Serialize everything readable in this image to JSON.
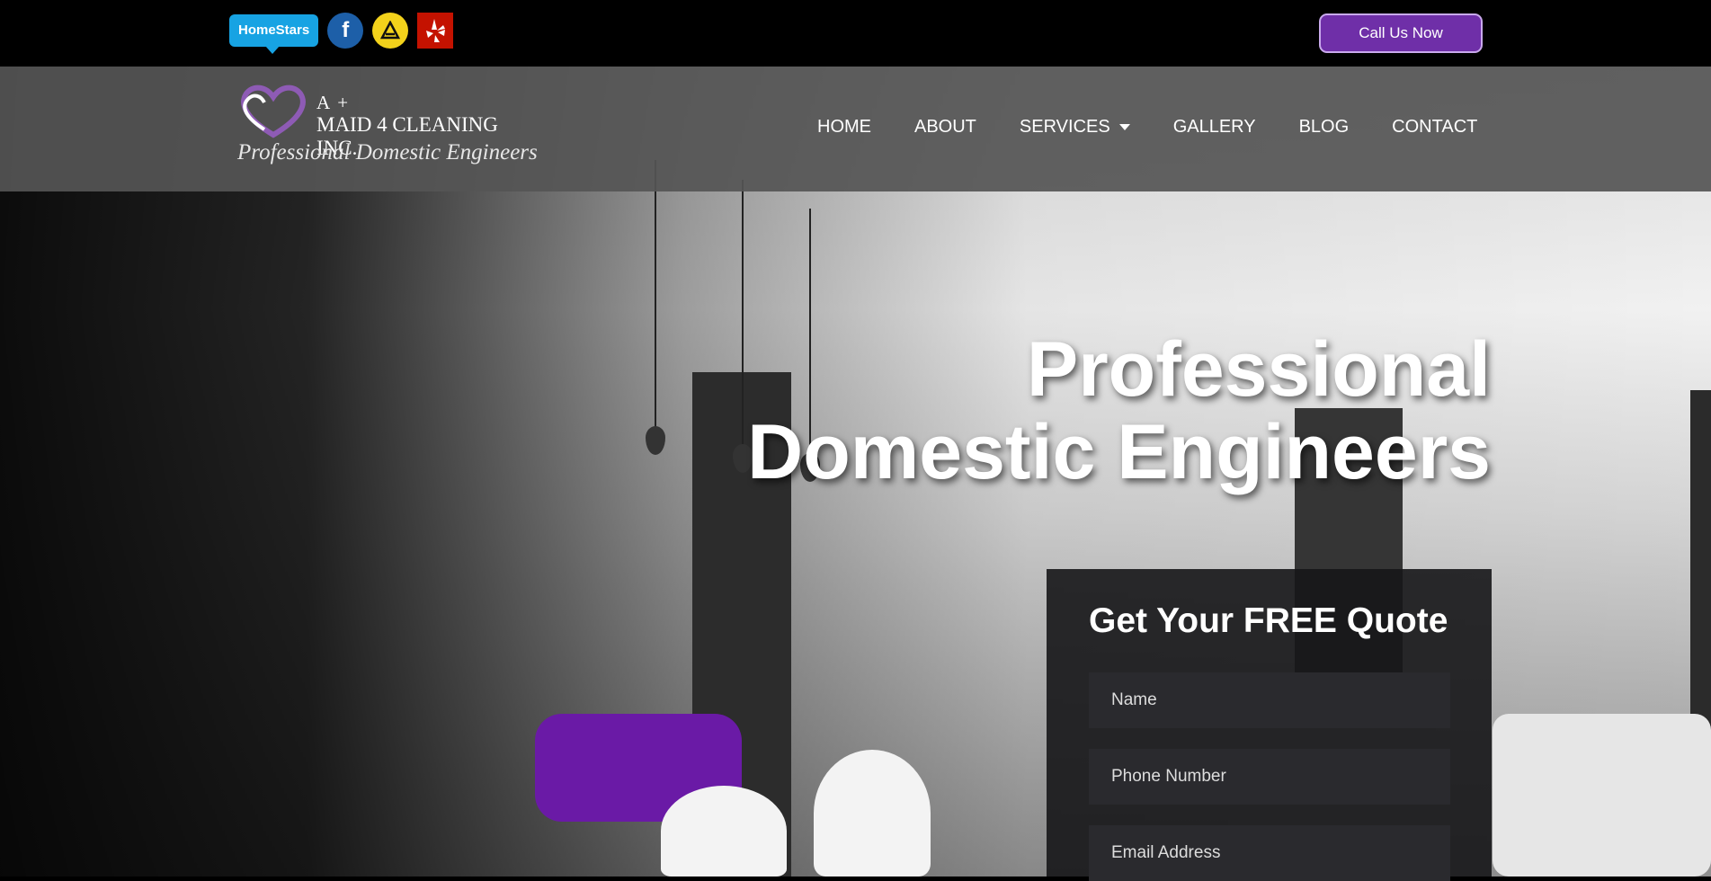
{
  "topbar": {
    "homestars_label": "HomeStars",
    "facebook_label": "f",
    "call_button": "Call Us Now"
  },
  "logo": {
    "line1": "A +",
    "line2": "MAID 4 CLEANING INC.",
    "tagline": "Professional Domestic Engineers"
  },
  "nav": {
    "items": [
      "HOME",
      "ABOUT",
      "SERVICES",
      "GALLERY",
      "BLOG",
      "CONTACT"
    ]
  },
  "hero": {
    "title_line1": "Professional",
    "title_line2": "Domestic Engineers"
  },
  "quote_form": {
    "heading": "Get Your FREE Quote",
    "name_placeholder": "Name",
    "phone_placeholder": "Phone Number",
    "email_placeholder": "Email Address"
  },
  "colors": {
    "accent": "#6f2fa8",
    "homestars": "#17a3e3",
    "facebook": "#1d5fa8",
    "yellowpages": "#f3d21b",
    "yelp": "#c41200"
  }
}
